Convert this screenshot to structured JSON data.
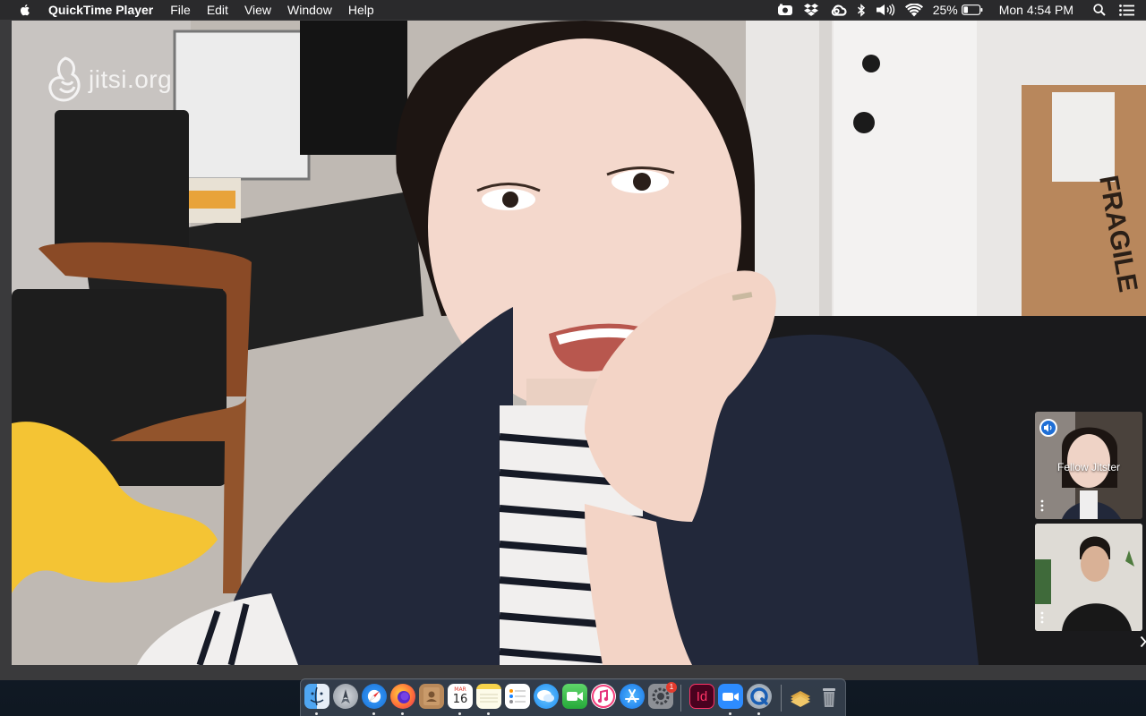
{
  "menubar": {
    "app_name": "QuickTime Player",
    "menus": [
      "File",
      "Edit",
      "View",
      "Window",
      "Help"
    ],
    "battery_percent": "25%",
    "clock": "Mon 4:54 PM",
    "status_icons": [
      "screen-record-icon",
      "dropbox-icon",
      "creative-cloud-icon",
      "bluetooth-icon",
      "volume-icon",
      "wifi-icon",
      "battery-icon",
      "spotlight-icon",
      "notification-center-icon"
    ]
  },
  "video": {
    "watermark_text": "jitsi.org",
    "thumbnails": [
      {
        "name": "Fellow Jitster",
        "active_speaker": true
      },
      {
        "name": "",
        "active_speaker": false
      }
    ]
  },
  "dock": {
    "apps": [
      {
        "id": "finder",
        "icon": "finder-icon",
        "running": true
      },
      {
        "id": "launchpad",
        "icon": "launchpad-icon",
        "running": false
      },
      {
        "id": "safari",
        "icon": "safari-icon",
        "running": true
      },
      {
        "id": "firefox",
        "icon": "firefox-icon",
        "running": true
      },
      {
        "id": "contacts",
        "icon": "contacts-icon",
        "running": false
      },
      {
        "id": "calendar",
        "icon": "calendar-icon",
        "running": true
      },
      {
        "id": "notes",
        "icon": "notes-icon",
        "running": true
      },
      {
        "id": "reminders",
        "icon": "reminders-icon",
        "running": false
      },
      {
        "id": "messages",
        "icon": "messages-icon",
        "running": false
      },
      {
        "id": "facetime",
        "icon": "facetime-icon",
        "running": false
      },
      {
        "id": "itunes",
        "icon": "itunes-icon",
        "running": false
      },
      {
        "id": "app-store",
        "icon": "app-store-icon",
        "running": false
      },
      {
        "id": "system-preferences",
        "icon": "system-preferences-icon",
        "running": false
      },
      {
        "id": "indesign",
        "icon": "indesign-icon",
        "running": false
      },
      {
        "id": "zoom",
        "icon": "zoom-icon",
        "running": true
      },
      {
        "id": "quicktime",
        "icon": "quicktime-icon",
        "running": true
      },
      {
        "id": "downloads",
        "icon": "downloads-stack-icon",
        "running": false
      },
      {
        "id": "trash",
        "icon": "trash-icon",
        "running": false
      }
    ],
    "calendar_month": "MAR",
    "calendar_day": "16",
    "indesign_label": "Id",
    "system_preferences_badge": "1"
  }
}
